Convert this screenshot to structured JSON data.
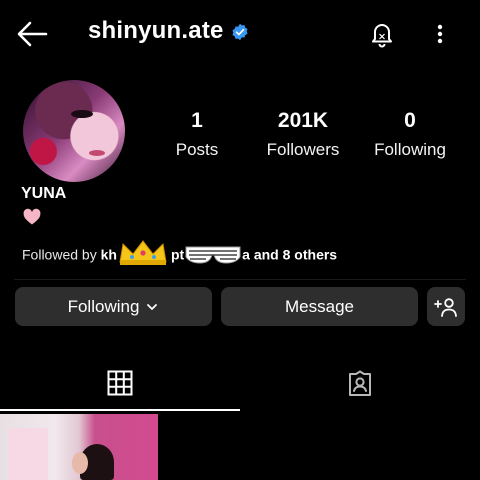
{
  "header": {
    "username": "shinyun.ate",
    "back_icon": "arrow-left-icon",
    "verified_icon": "verified-badge-icon",
    "bell_icon": "bell-icon",
    "more_icon": "more-vertical-icon",
    "verified_color": "#3897f0"
  },
  "profile": {
    "display_name": "YUNA",
    "bio_emoji": "heart-emoji",
    "stats": [
      {
        "value": "1",
        "label": "Posts"
      },
      {
        "value": "201K",
        "label": "Followers"
      },
      {
        "value": "0",
        "label": "Following"
      }
    ]
  },
  "followed_by": {
    "prefix": "Followed by",
    "name1_start": "kh",
    "name2_start": "pt",
    "name2_end": "a",
    "suffix": "and 8 others"
  },
  "actions": {
    "following_label": "Following",
    "message_label": "Message",
    "add_user_icon": "add-user-icon"
  },
  "tabs": {
    "grid_icon": "grid-icon",
    "tagged_icon": "tagged-person-icon",
    "active": "grid"
  }
}
